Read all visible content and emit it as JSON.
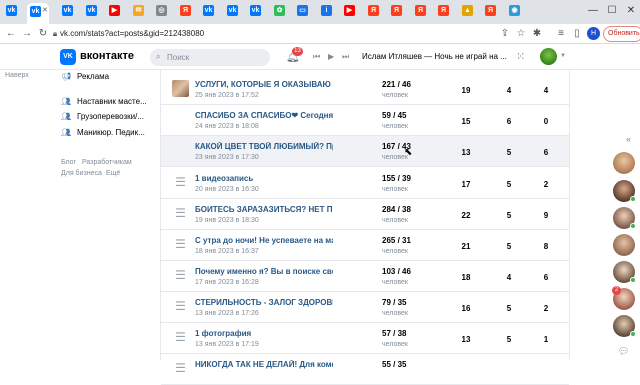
{
  "browser": {
    "tabs": [
      {
        "icon": "vk-icon",
        "color": "#0077ff",
        "glyph": "vk"
      },
      {
        "icon": "vk-icon",
        "color": "#0077ff",
        "glyph": "vk",
        "active": true
      },
      {
        "icon": "vk-icon",
        "color": "#0077ff",
        "glyph": "vk"
      },
      {
        "icon": "vk-icon",
        "color": "#0077ff",
        "glyph": "vk"
      },
      {
        "icon": "youtube-icon",
        "color": "#ff0000",
        "glyph": "▶"
      },
      {
        "icon": "mail-icon",
        "color": "#f5a623",
        "glyph": "✉"
      },
      {
        "icon": "globe-icon",
        "color": "#7f8790",
        "glyph": "◎"
      },
      {
        "icon": "yandex-icon",
        "color": "#fc3f1d",
        "glyph": "Я"
      },
      {
        "icon": "vk-icon",
        "color": "#0077ff",
        "glyph": "vk"
      },
      {
        "icon": "vk-icon",
        "color": "#0077ff",
        "glyph": "vk"
      },
      {
        "icon": "vk-icon",
        "color": "#0077ff",
        "glyph": "vk"
      },
      {
        "icon": "app-icon",
        "color": "#2ebd59",
        "glyph": "✿"
      },
      {
        "icon": "messages-icon",
        "color": "#1a73e8",
        "glyph": "▭"
      },
      {
        "icon": "info-icon",
        "color": "#1a73e8",
        "glyph": "i"
      },
      {
        "icon": "youtube-icon",
        "color": "#ff0000",
        "glyph": "▶"
      },
      {
        "icon": "yandex-icon",
        "color": "#fc3f1d",
        "glyph": "Я"
      },
      {
        "icon": "yandex-icon",
        "color": "#fc3f1d",
        "glyph": "Я"
      },
      {
        "icon": "yandex-icon",
        "color": "#fc3f1d",
        "glyph": "Я"
      },
      {
        "icon": "yandex-icon",
        "color": "#fc3f1d",
        "glyph": "Я"
      },
      {
        "icon": "image-icon",
        "color": "#e2a400",
        "glyph": "▲"
      },
      {
        "icon": "yandex-icon",
        "color": "#fc3f1d",
        "glyph": "Я"
      },
      {
        "icon": "app-icon",
        "color": "#2e9bd6",
        "glyph": "◉"
      }
    ],
    "close_tab": "✕",
    "url": "vk.com/stats?act=posts&gid=212438080",
    "profile_letter": "Н",
    "update_label": "Обновить"
  },
  "vk_header": {
    "logo": "VK",
    "brand": "вконтакте",
    "search_placeholder": "Поиск",
    "notification_count": "13",
    "now_playing": "Ислам Итляшев — Ночь не играй на ..."
  },
  "left_nav": {
    "top_link": "Наверх",
    "items": [
      {
        "label": "Реклама",
        "icon": "megaphone-icon"
      },
      {
        "label": "Наставник масте...",
        "icon": "group-icon"
      },
      {
        "label": "Грузоперевозки/...",
        "icon": "group-icon"
      },
      {
        "label": "Маникюр. Педик...",
        "icon": "group-icon"
      }
    ],
    "footer": {
      "blog": "Блог",
      "developers": "Разработчикам",
      "business": "Для бизнеса",
      "more": "Ещё"
    }
  },
  "posts": [
    {
      "title": "УСЛУГИ, КОТОРЫЕ Я ОКАЗЫВАЮ ДЛЯ ...",
      "date": "25 янв 2023 в 17:52",
      "reach": "221 / 46",
      "unit": "человек",
      "a": "19",
      "b": "4",
      "c": "4",
      "thumb": "photo"
    },
    {
      "title": "СПАСИБО ЗА СПАСИБО❤ Сегодня хочу ...",
      "date": "24 янв 2023 в 18:08",
      "reach": "59 / 45",
      "unit": "человек",
      "a": "15",
      "b": "6",
      "c": "0",
      "thumb": "none"
    },
    {
      "title": "КАКОЙ ЦВЕТ ТВОЙ ЛЮБИМЫЙ? Пришла...",
      "date": "23 янв 2023 в 17:30",
      "reach": "167 / 43",
      "unit": "человек",
      "a": "13",
      "b": "5",
      "c": "6",
      "thumb": "none",
      "highlight": true
    },
    {
      "title": "1 видеозапись",
      "date": "20 янв 2023 в 16:30",
      "reach": "155 / 39",
      "unit": "человек",
      "a": "17",
      "b": "5",
      "c": "2",
      "thumb": "doc"
    },
    {
      "title": "БОИТЕСЬ ЗАРАЗАЗИТЬСЯ? НЕТ ПРИЧИ...",
      "date": "19 янв 2023 в 18:30",
      "reach": "284 / 38",
      "unit": "человек",
      "a": "22",
      "b": "5",
      "c": "9",
      "thumb": "doc"
    },
    {
      "title": "С утра до ночи! Не успеваете на маникю...",
      "date": "18 янв 2023 в 16:37",
      "reach": "265 / 31",
      "unit": "человек",
      "a": "21",
      "b": "5",
      "c": "8",
      "thumb": "doc"
    },
    {
      "title": "Почему именно я? Вы в поиске своего ...",
      "date": "17 янв 2023 в 16:28",
      "reach": "103 / 46",
      "unit": "человек",
      "a": "18",
      "b": "4",
      "c": "6",
      "thumb": "doc"
    },
    {
      "title": "СТЕРИЛЬНОСТЬ - ЗАЛОГ ЗДОРОВЬЯ! И ...",
      "date": "13 янв 2023 в 17:26",
      "reach": "79 / 35",
      "unit": "человек",
      "a": "16",
      "b": "5",
      "c": "2",
      "thumb": "doc"
    },
    {
      "title": "1 фотография",
      "date": "13 янв 2023 в 17:19",
      "reach": "57 / 38",
      "unit": "человек",
      "a": "13",
      "b": "5",
      "c": "1",
      "thumb": "doc"
    },
    {
      "title": "НИКОГДА ТАК НЕ ДЕЛАЙ! Для комфорт...",
      "date": "",
      "reach": "55 / 35",
      "unit": "",
      "a": "",
      "b": "",
      "c": "",
      "thumb": "doc"
    }
  ],
  "right_strip": {
    "badge": "2"
  }
}
